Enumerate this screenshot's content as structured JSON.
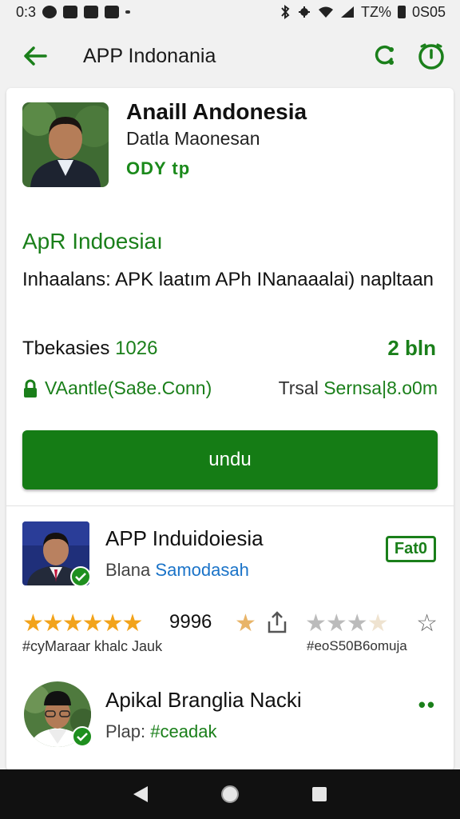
{
  "status_bar": {
    "time": "0:3",
    "battery": "TZ%",
    "clock": "0S05"
  },
  "app_bar": {
    "title": "APP Indonania"
  },
  "hero": {
    "name": "Anaill Andonesia",
    "subtitle": "Datla Maonesan",
    "tag": "ODY tp"
  },
  "section": {
    "title": "ApR Indoesiaı",
    "description": "Inhaalans: APK laatım APh INanaaalai) napltaan"
  },
  "stats": {
    "label": "Tbekasies",
    "count": "1026",
    "right": "2 bln"
  },
  "vendor": "VAantle(Sa8e.Conn)",
  "size": {
    "label": "Trsal",
    "value": "Sernsa|8.o0m"
  },
  "cta_label": "undu",
  "item1": {
    "title": "APP Induidoiesia",
    "subtitle_prefix": "Blana",
    "subtitle_link": "Samodasah",
    "tag": "Fat0"
  },
  "rating": {
    "count": "9996",
    "meta_left": "#cyMaraar khalc Jauk",
    "meta_right": "#eoS50B6omuja"
  },
  "item2": {
    "title": "Apikal Branglia Nacki",
    "subtitle_prefix": "Plap:",
    "subtitle_value": "#ceadak",
    "more": "••"
  },
  "colors": {
    "accent": "#157c15",
    "link": "#1a73c8",
    "star": "#f2a31b"
  }
}
